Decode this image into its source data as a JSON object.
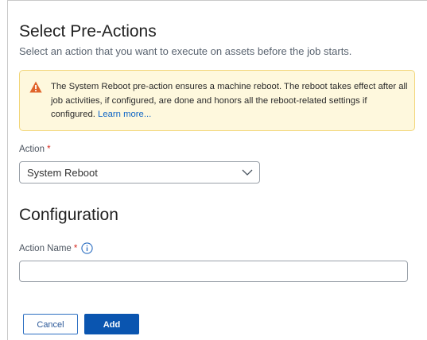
{
  "header": {
    "title": "Select Pre-Actions",
    "subtitle": "Select an action that you want to execute on assets before the job starts."
  },
  "alert": {
    "icon": "warning-icon",
    "message": "The System Reboot pre-action ensures a machine reboot. The reboot takes effect after all job activities, if configured, are done and honors all the reboot-related settings if configured.",
    "link_text": "Learn more...",
    "colors": {
      "background": "#fef8dd",
      "border": "#f2d67a",
      "icon": "#e0642a"
    }
  },
  "action_field": {
    "label": "Action",
    "required_mark": "*",
    "selected_value": "System Reboot"
  },
  "configuration": {
    "title": "Configuration",
    "action_name": {
      "label": "Action Name",
      "required_mark": "*",
      "value": "",
      "placeholder": ""
    }
  },
  "footer": {
    "cancel_label": "Cancel",
    "add_label": "Add"
  },
  "colors": {
    "primary": "#0a55b0",
    "required": "#d6291f",
    "link": "#0b63c5"
  }
}
